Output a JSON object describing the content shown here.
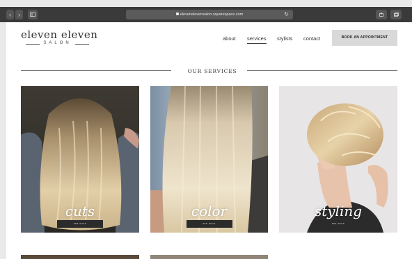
{
  "browser": {
    "url": "elevenelevensalon.squarespace.com",
    "back_icon": "chevron-left-icon",
    "forward_icon": "chevron-right-icon",
    "sidebar_icon": "sidebar-icon",
    "share_icon": "share-icon",
    "tabs_icon": "tabs-icon",
    "reload_icon": "reload-icon"
  },
  "header": {
    "logo_main": "eleven eleven",
    "logo_sub": "SALON",
    "nav": [
      "about",
      "services",
      "stylists",
      "contact"
    ],
    "active_nav": "services",
    "cta_label": "BOOK AN APPOINTMENT"
  },
  "services": {
    "section_title": "OUR SERVICES",
    "cards": [
      {
        "title": "cuts",
        "button": "see more"
      },
      {
        "title": "color",
        "button": "see more"
      },
      {
        "title": "styling",
        "button": "see more"
      }
    ]
  },
  "colors": {
    "chrome": "#3a3a3a",
    "cta_bg": "#d9d9d9",
    "button_dark": "#2b2b2b"
  }
}
